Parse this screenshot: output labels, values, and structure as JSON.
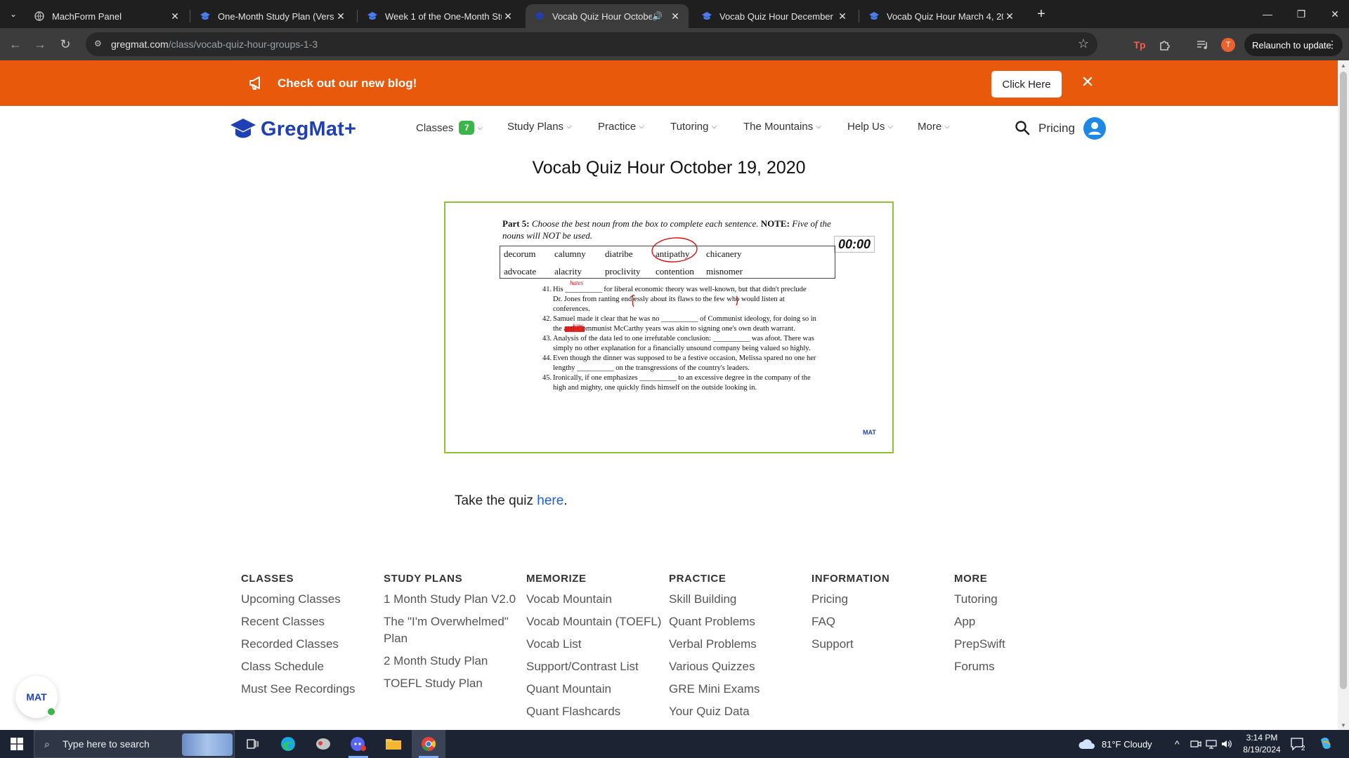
{
  "browser": {
    "tabs": [
      {
        "title": "MachForm Panel",
        "active": false
      },
      {
        "title": "One-Month Study Plan (Version",
        "active": false
      },
      {
        "title": "Week 1 of the One-Month Stud",
        "active": false
      },
      {
        "title": "Vocab Quiz Hour October 1",
        "active": true
      },
      {
        "title": "Vocab Quiz Hour December 30,",
        "active": false
      },
      {
        "title": "Vocab Quiz Hour March 4, 2021",
        "active": false
      }
    ],
    "url_host": "gregmat.com",
    "url_path": "/class/vocab-quiz-hour-groups-1-3",
    "profile_initial": "T",
    "relaunch_label": "Relaunch to update"
  },
  "banner": {
    "text": "Check out our new blog!",
    "button_label": "Click Here"
  },
  "nav": {
    "logo": "GregMat+",
    "classes_label": "Classes",
    "classes_badge": "7",
    "items": [
      "Study Plans",
      "Practice",
      "Tutoring",
      "The Mountains",
      "Help Us",
      "More"
    ],
    "pricing_label": "Pricing"
  },
  "page": {
    "title": "Vocab Quiz Hour October 19, 2020",
    "take_quiz_prefix": "Take the quiz ",
    "take_quiz_link": "here",
    "take_quiz_suffix": "."
  },
  "quiz_image": {
    "part_label": "Part 5:",
    "instruction": "Choose the best noun from the box to complete each sentence.",
    "note_label": "NOTE:",
    "note_text": "Five of the nouns will NOT be used.",
    "timer": "00:00",
    "words_row1": [
      "decorum",
      "calumny",
      "diatribe",
      "antipathy",
      "chicanery"
    ],
    "words_row2": [
      "advocate",
      "alacrity",
      "proclivity",
      "contention",
      "misnomer"
    ],
    "questions": [
      {
        "num": "41.",
        "text": "His __________ for liberal economic theory was well-known, but that didn't preclude Dr. Jones from ranting endlessly about its flaws to the few who would listen at conferences."
      },
      {
        "num": "42.",
        "text": "Samuel made it clear that he was no __________ of Communist ideology, for doing so in the anti-Communist McCarthy years was akin to signing one's own death warrant."
      },
      {
        "num": "43.",
        "text": "Analysis of the data led to one irrefutable conclusion: __________ was afoot. There was simply no other explanation for a financially unsound company being valued so highly."
      },
      {
        "num": "44.",
        "text": "Even though the dinner was supposed to be a festive occasion, Melissa spared no one her lengthy __________ on the transgressions of the country's leaders."
      },
      {
        "num": "45.",
        "text": "Ironically, if one emphasizes __________ to an excessive degree in the company of the high and mighty, one quickly finds himself on the outside looking in."
      }
    ],
    "annotation_41": "hates",
    "annotation_42": "being",
    "watermark": "MAT"
  },
  "footer": {
    "columns": [
      {
        "heading": "CLASSES",
        "links": [
          "Upcoming Classes",
          "Recent Classes",
          "Recorded Classes",
          "Class Schedule",
          "Must See Recordings"
        ]
      },
      {
        "heading": "STUDY PLANS",
        "links": [
          "1 Month Study Plan V2.0",
          "The \"I'm Overwhelmed\" Plan",
          "2 Month Study Plan",
          "TOEFL Study Plan"
        ]
      },
      {
        "heading": "MEMORIZE",
        "links": [
          "Vocab Mountain",
          "Vocab Mountain (TOEFL)",
          "Vocab List",
          "Support/Contrast List",
          "Quant Mountain",
          "Quant Flashcards"
        ]
      },
      {
        "heading": "PRACTICE",
        "links": [
          "Skill Building",
          "Quant Problems",
          "Verbal Problems",
          "Various Quizzes",
          "GRE Mini Exams",
          "Your Quiz Data"
        ]
      },
      {
        "heading": "INFORMATION",
        "links": [
          "Pricing",
          "FAQ",
          "Support"
        ]
      },
      {
        "heading": "MORE",
        "links": [
          "Tutoring",
          "App",
          "PrepSwift",
          "Forums"
        ]
      }
    ]
  },
  "chat_widget": {
    "label": "MAT"
  },
  "taskbar": {
    "search_placeholder": "Type here to search",
    "weather": "81°F  Cloudy",
    "time": "3:14 PM",
    "date": "8/19/2024",
    "notification_count": "2"
  }
}
